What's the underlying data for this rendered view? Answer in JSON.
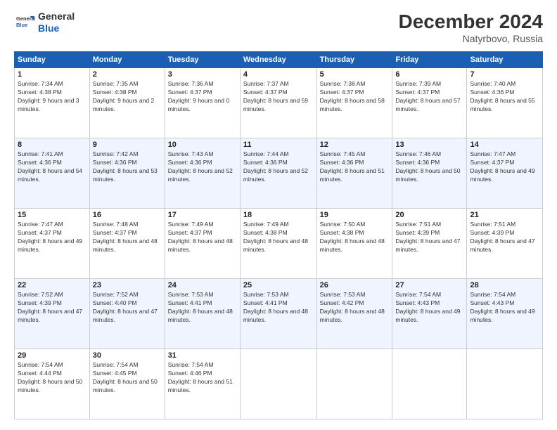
{
  "logo": {
    "line1": "General",
    "line2": "Blue"
  },
  "title": "December 2024",
  "subtitle": "Natyrbovo, Russia",
  "headers": [
    "Sunday",
    "Monday",
    "Tuesday",
    "Wednesday",
    "Thursday",
    "Friday",
    "Saturday"
  ],
  "weeks": [
    [
      {
        "day": "1",
        "sunrise": "7:34 AM",
        "sunset": "4:38 PM",
        "daylight": "9 hours and 3 minutes."
      },
      {
        "day": "2",
        "sunrise": "7:35 AM",
        "sunset": "4:38 PM",
        "daylight": "9 hours and 2 minutes."
      },
      {
        "day": "3",
        "sunrise": "7:36 AM",
        "sunset": "4:37 PM",
        "daylight": "9 hours and 0 minutes."
      },
      {
        "day": "4",
        "sunrise": "7:37 AM",
        "sunset": "4:37 PM",
        "daylight": "8 hours and 59 minutes."
      },
      {
        "day": "5",
        "sunrise": "7:38 AM",
        "sunset": "4:37 PM",
        "daylight": "8 hours and 58 minutes."
      },
      {
        "day": "6",
        "sunrise": "7:39 AM",
        "sunset": "4:37 PM",
        "daylight": "8 hours and 57 minutes."
      },
      {
        "day": "7",
        "sunrise": "7:40 AM",
        "sunset": "4:36 PM",
        "daylight": "8 hours and 55 minutes."
      }
    ],
    [
      {
        "day": "8",
        "sunrise": "7:41 AM",
        "sunset": "4:36 PM",
        "daylight": "8 hours and 54 minutes."
      },
      {
        "day": "9",
        "sunrise": "7:42 AM",
        "sunset": "4:36 PM",
        "daylight": "8 hours and 53 minutes."
      },
      {
        "day": "10",
        "sunrise": "7:43 AM",
        "sunset": "4:36 PM",
        "daylight": "8 hours and 52 minutes."
      },
      {
        "day": "11",
        "sunrise": "7:44 AM",
        "sunset": "4:36 PM",
        "daylight": "8 hours and 52 minutes."
      },
      {
        "day": "12",
        "sunrise": "7:45 AM",
        "sunset": "4:36 PM",
        "daylight": "8 hours and 51 minutes."
      },
      {
        "day": "13",
        "sunrise": "7:46 AM",
        "sunset": "4:36 PM",
        "daylight": "8 hours and 50 minutes."
      },
      {
        "day": "14",
        "sunrise": "7:47 AM",
        "sunset": "4:37 PM",
        "daylight": "8 hours and 49 minutes."
      }
    ],
    [
      {
        "day": "15",
        "sunrise": "7:47 AM",
        "sunset": "4:37 PM",
        "daylight": "8 hours and 49 minutes."
      },
      {
        "day": "16",
        "sunrise": "7:48 AM",
        "sunset": "4:37 PM",
        "daylight": "8 hours and 48 minutes."
      },
      {
        "day": "17",
        "sunrise": "7:49 AM",
        "sunset": "4:37 PM",
        "daylight": "8 hours and 48 minutes."
      },
      {
        "day": "18",
        "sunrise": "7:49 AM",
        "sunset": "4:38 PM",
        "daylight": "8 hours and 48 minutes."
      },
      {
        "day": "19",
        "sunrise": "7:50 AM",
        "sunset": "4:38 PM",
        "daylight": "8 hours and 48 minutes."
      },
      {
        "day": "20",
        "sunrise": "7:51 AM",
        "sunset": "4:39 PM",
        "daylight": "8 hours and 47 minutes."
      },
      {
        "day": "21",
        "sunrise": "7:51 AM",
        "sunset": "4:39 PM",
        "daylight": "8 hours and 47 minutes."
      }
    ],
    [
      {
        "day": "22",
        "sunrise": "7:52 AM",
        "sunset": "4:39 PM",
        "daylight": "8 hours and 47 minutes."
      },
      {
        "day": "23",
        "sunrise": "7:52 AM",
        "sunset": "4:40 PM",
        "daylight": "8 hours and 47 minutes."
      },
      {
        "day": "24",
        "sunrise": "7:53 AM",
        "sunset": "4:41 PM",
        "daylight": "8 hours and 48 minutes."
      },
      {
        "day": "25",
        "sunrise": "7:53 AM",
        "sunset": "4:41 PM",
        "daylight": "8 hours and 48 minutes."
      },
      {
        "day": "26",
        "sunrise": "7:53 AM",
        "sunset": "4:42 PM",
        "daylight": "8 hours and 48 minutes."
      },
      {
        "day": "27",
        "sunrise": "7:54 AM",
        "sunset": "4:43 PM",
        "daylight": "8 hours and 49 minutes."
      },
      {
        "day": "28",
        "sunrise": "7:54 AM",
        "sunset": "4:43 PM",
        "daylight": "8 hours and 49 minutes."
      }
    ],
    [
      {
        "day": "29",
        "sunrise": "7:54 AM",
        "sunset": "4:44 PM",
        "daylight": "8 hours and 50 minutes."
      },
      {
        "day": "30",
        "sunrise": "7:54 AM",
        "sunset": "4:45 PM",
        "daylight": "8 hours and 50 minutes."
      },
      {
        "day": "31",
        "sunrise": "7:54 AM",
        "sunset": "4:46 PM",
        "daylight": "8 hours and 51 minutes."
      },
      null,
      null,
      null,
      null
    ]
  ]
}
